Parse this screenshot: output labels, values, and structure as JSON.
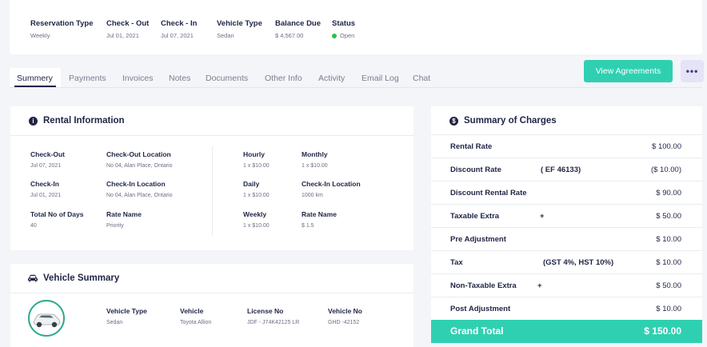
{
  "header": {
    "reservation_type": {
      "label": "Reservation Type",
      "value": "Weekly"
    },
    "check_out": {
      "label": "Check - Out",
      "value": "Jul 01, 2021"
    },
    "check_in": {
      "label": "Check - In",
      "value": "Jul 07, 2021"
    },
    "vehicle_type": {
      "label": "Vehicle Type",
      "value": "Sedan"
    },
    "balance_due": {
      "label": "Balance Due",
      "value": "$ 4,567.00"
    },
    "status": {
      "label": "Status",
      "value": "Open",
      "color": "#27c24c"
    }
  },
  "tabs": [
    "Summery",
    "Payments",
    "Invoices",
    "Notes",
    "Documents",
    "Other Info",
    "Activity",
    "Email Log",
    "Chat"
  ],
  "actions": {
    "view_agreements": "View Agreements",
    "more": "•••"
  },
  "rental_info": {
    "title": "Rental Information",
    "check_out": {
      "label": "Check-Out",
      "value": "Jul 07, 2021"
    },
    "check_out_location": {
      "label": "Check-Out Location",
      "value": "No 04, Alan Place, Ontario"
    },
    "hourly": {
      "label": "Hourly",
      "value": "1 x $10.00"
    },
    "monthly": {
      "label": "Monthly",
      "value": "1 x $10.00"
    },
    "check_in": {
      "label": "Check-In",
      "value": "Jul 01, 2021"
    },
    "check_in_location_left": {
      "label": "Check-In Location",
      "value": "No 04, Alan Place, Ontario"
    },
    "daily": {
      "label": "Daily",
      "value": "1 x $10.00"
    },
    "check_in_location_right": {
      "label": "Check-In Location",
      "value": "1000 km"
    },
    "total_days": {
      "label": "Total No of Days",
      "value": "40"
    },
    "rate_name_left": {
      "label": "Rate Name",
      "value": "Priority"
    },
    "weekly": {
      "label": "Weekly",
      "value": "1 x $10.00"
    },
    "rate_name_right": {
      "label": "Rate Name",
      "value": "$ 1.5"
    }
  },
  "vehicle_summary": {
    "title": "Vehicle Summary",
    "vehicle_type": {
      "label": "Vehicle Type",
      "value": "Sedan"
    },
    "vehicle": {
      "label": "Vehicle",
      "value": "Toyota Allion"
    },
    "license_no": {
      "label": "License No",
      "value": "JDF - J74K42125 LR"
    },
    "vehicle_no": {
      "label": "Vehicle No",
      "value": "GHD -42152"
    }
  },
  "charges": {
    "title": "Summary of Charges",
    "rows": [
      {
        "label": "Rental Rate",
        "mid": "",
        "amount": "$ 100.00"
      },
      {
        "label": "Discount Rate",
        "mid": "( EF 46133)",
        "amount": "($ 10.00)"
      },
      {
        "label": "Discount Rental Rate",
        "mid": "",
        "amount": "$ 90.00"
      },
      {
        "label": "Taxable Extra",
        "mid": "+",
        "amount": "$ 50.00"
      },
      {
        "label": "Pre Adjustment",
        "mid": "",
        "amount": "$ 10.00"
      },
      {
        "label": "Tax",
        "mid": "(GST 4%, HST 10%)",
        "amount": "$ 10.00"
      },
      {
        "label": "Non-Taxable Extra",
        "mid": "+",
        "amount": "$ 50.00"
      },
      {
        "label": "Post Adjustment",
        "mid": "",
        "amount": "$ 10.00"
      }
    ],
    "grand_total": {
      "label": "Grand Total",
      "amount": "$ 150.00"
    }
  },
  "colors": {
    "accent": "#2fd0b1",
    "dark": "#1f2445",
    "status_open": "#27c24c"
  }
}
